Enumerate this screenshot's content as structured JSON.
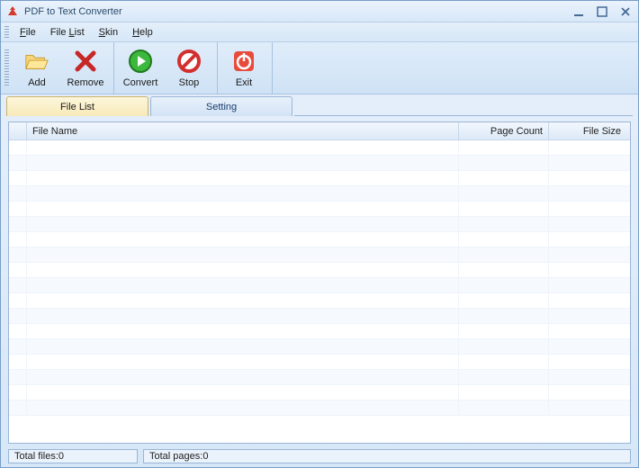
{
  "window": {
    "title": "PDF to Text Converter"
  },
  "menu": {
    "file": "File",
    "filelist": "File List",
    "skin": "Skin",
    "help": "Help"
  },
  "toolbar": {
    "add": "Add",
    "remove": "Remove",
    "convert": "Convert",
    "stop": "Stop",
    "exit": "Exit"
  },
  "tabs": {
    "filelist": "File List",
    "setting": "Setting"
  },
  "columns": {
    "filename": "File Name",
    "pagecount": "Page Count",
    "filesize": "File Size"
  },
  "status": {
    "totalfiles_label": "Total files: ",
    "totalfiles_value": "0",
    "totalpages_label": "Total pages: ",
    "totalpages_value": "0"
  },
  "colors": {
    "accent": "#d6e7f7",
    "border": "#9ab5d6",
    "active_tab_bg": "#f7e9b8"
  }
}
